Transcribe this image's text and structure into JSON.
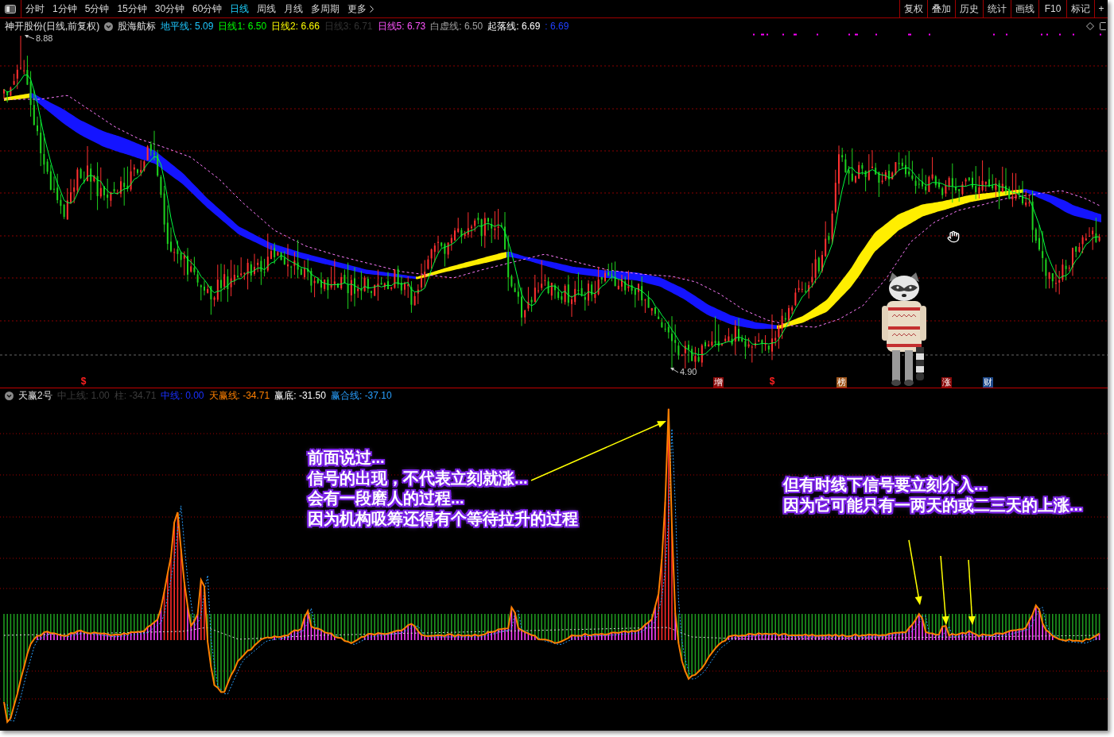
{
  "toolbar": {
    "periods": [
      {
        "label": "分时",
        "selected": false
      },
      {
        "label": "1分钟",
        "selected": false
      },
      {
        "label": "5分钟",
        "selected": false
      },
      {
        "label": "15分钟",
        "selected": false
      },
      {
        "label": "30分钟",
        "selected": false
      },
      {
        "label": "60分钟",
        "selected": false
      },
      {
        "label": "日线",
        "selected": true
      },
      {
        "label": "周线",
        "selected": false
      },
      {
        "label": "月线",
        "selected": false
      },
      {
        "label": "多周期",
        "selected": false
      }
    ],
    "more": "更多",
    "tools": [
      "复权",
      "叠加",
      "历史",
      "统计",
      "画线",
      "F10",
      "标记",
      "+"
    ]
  },
  "main_chart": {
    "title": "神开股份(日线,前复权)",
    "indicator": "股海航标",
    "legend": [
      {
        "label": "地平线:",
        "value": "5.09",
        "color": "#1ec8ff"
      },
      {
        "label": "日线1:",
        "value": "6.50",
        "color": "#00ff00"
      },
      {
        "label": "日线2:",
        "value": "6.66",
        "color": "#ffff00"
      },
      {
        "label": "日线3:",
        "value": "6.71",
        "color": "#333333"
      },
      {
        "label": "日线5:",
        "value": "6.73",
        "color": "#ff55ff"
      },
      {
        "label": "白虚线:",
        "value": "6.50",
        "color": "#a0a0a0"
      },
      {
        "label": "起落线:",
        "value": "6.69",
        "color": "#ffffff"
      },
      {
        "label": ":",
        "value": "6.69",
        "color": "#2040ff"
      }
    ],
    "high_label": "8.88",
    "low_label": "4.90",
    "markers": [
      {
        "kind": "sign",
        "text": "$",
        "color": "#ff2020"
      },
      {
        "kind": "tag",
        "text": "增",
        "color": "#8b0a0a"
      },
      {
        "kind": "sign",
        "text": "$",
        "color": "#ff2020"
      },
      {
        "kind": "tag",
        "text": "榜",
        "color": "#a0561c"
      },
      {
        "kind": "tag",
        "text": "涨",
        "color": "#8b0a0a"
      },
      {
        "kind": "tag",
        "text": "财",
        "color": "#1e4a8c"
      }
    ]
  },
  "sub_chart": {
    "name": "天赢2号",
    "legend": [
      {
        "label": "中上线:",
        "value": "1.00",
        "color": "#3c3c3c"
      },
      {
        "label": "柱:",
        "value": "-34.71",
        "color": "#3c3c3c"
      },
      {
        "label": "中线:",
        "value": "0.00",
        "color": "#1a30ff"
      },
      {
        "label": "天赢线:",
        "value": "-34.71",
        "color": "#ff8000"
      },
      {
        "label": "赢底:",
        "value": "-31.50",
        "color": "#ffffff"
      },
      {
        "label": "赢合线:",
        "value": "-37.10",
        "color": "#29a0ff"
      }
    ]
  },
  "annotations": [
    {
      "lines": [
        "前面说过...",
        "信号的出现，不代表立刻就涨...",
        "会有一段磨人的过程...",
        "因为机构吸筹还得有个等待拉升的过程"
      ]
    },
    {
      "lines": [
        "但有时线下信号要立刻介入...",
        "因为它可能只有一两天的或二三天的上涨..."
      ]
    }
  ]
}
